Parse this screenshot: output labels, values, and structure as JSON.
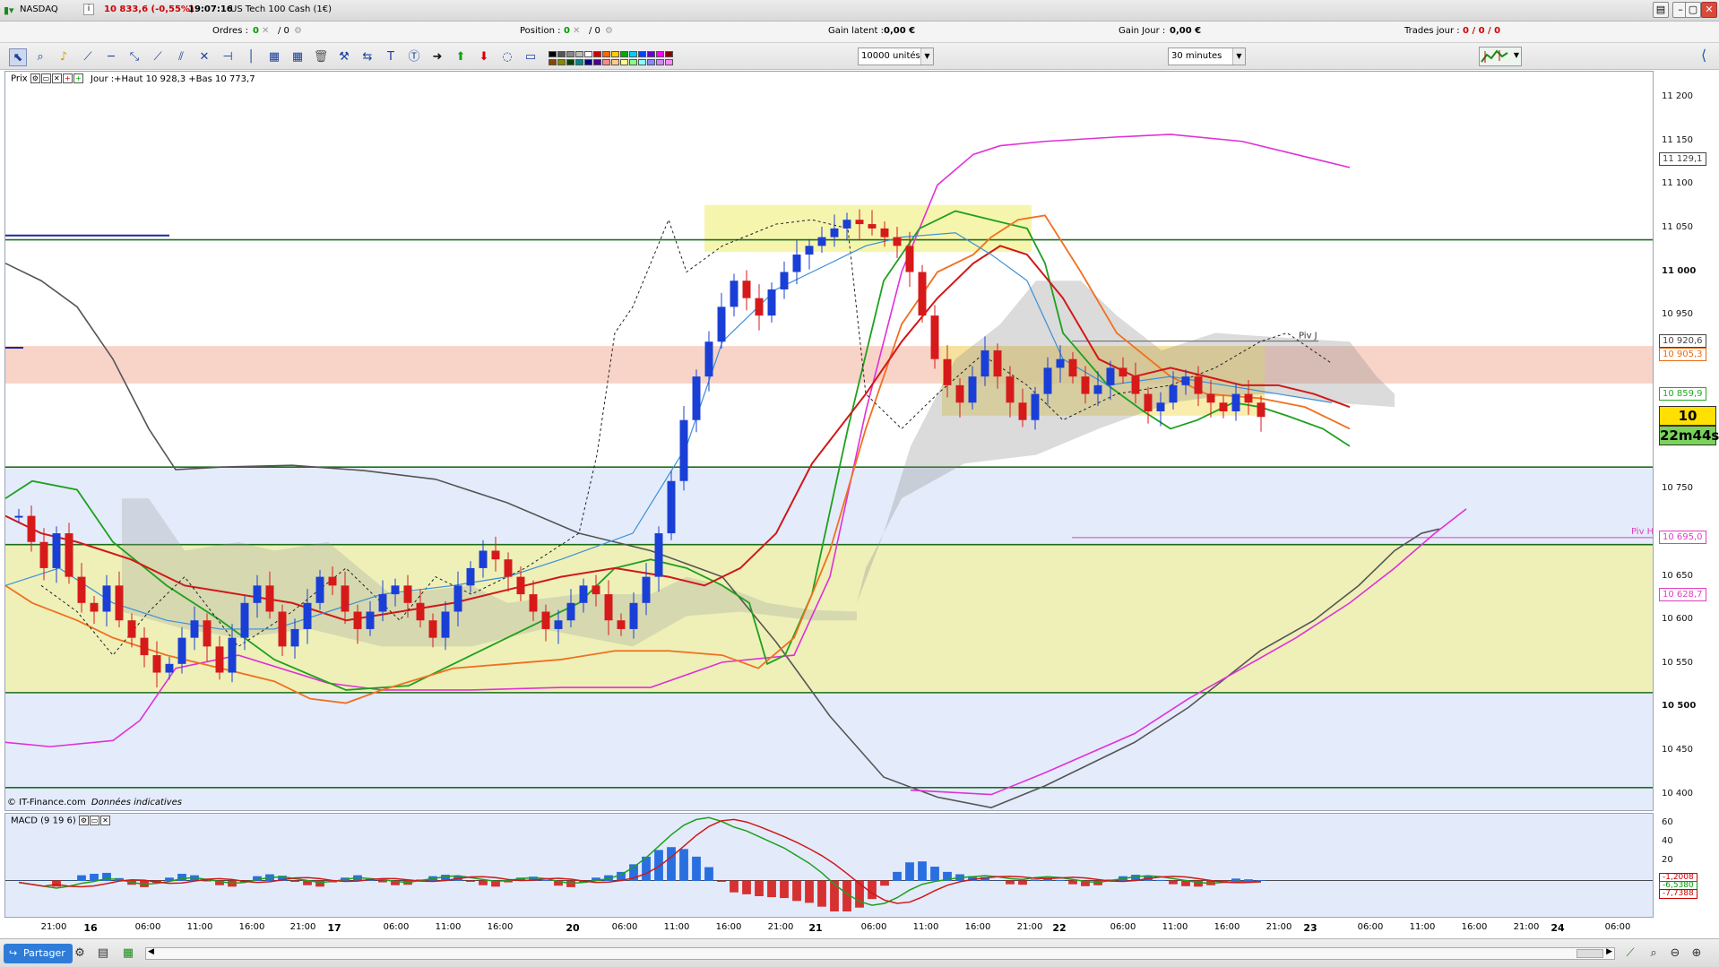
{
  "topbar": {
    "market": "NASDAQ",
    "info_icon": "i",
    "quote": "10 833,6 (-0,55%)",
    "time": "19:07:16",
    "instrument": "US Tech 100 Cash (1€)",
    "orders_label": "Ordres :",
    "orders_a": "0",
    "orders_b": "/ 0",
    "position_label": "Position :",
    "position_a": "0",
    "position_b": "/ 0",
    "gain_latent_label": "Gain latent :",
    "gain_latent_value": "0,00 €",
    "gain_jour_label": "Gain Jour :",
    "gain_jour_value": "0,00 €",
    "trades_label": "Trades jour :",
    "trades_value": "0 / 0 / 0"
  },
  "toolbar": {
    "units_select": "10000 unités",
    "period_select": "30 minutes",
    "icons": [
      "cursor-icon",
      "zoom-icon",
      "alert-bell-icon",
      "ruler-icon",
      "horizontal-line-icon",
      "trendline-icon",
      "ray-icon",
      "channel-icon",
      "fibonacci-icon",
      "vertical-line-icon",
      "ellipse-icon",
      "arc-icon",
      "text-icon",
      "callout-icon",
      "arrow-right-icon",
      "arrow-up-icon",
      "arrow-down-icon",
      "rectangle-icon",
      "delete-icon",
      "magnet-icon"
    ],
    "swatch_colors": [
      "#000000",
      "#555555",
      "#888888",
      "#bbbbbb",
      "#ffffff",
      "#d00000",
      "#ff6600",
      "#ffcc00",
      "#00aa00",
      "#00ccff",
      "#0044ff",
      "#6600cc",
      "#ff00ff",
      "#880000",
      "#884400",
      "#888800",
      "#004400",
      "#008888",
      "#000088",
      "#440088",
      "#ff8888",
      "#ffcc88",
      "#ffff88",
      "#88ff88",
      "#88ffff",
      "#8888ff",
      "#cc88ff",
      "#ff88ff"
    ]
  },
  "prix_bar": {
    "label": "Prix",
    "jour_info": "Jour :+Haut 10 928,3 +Bas 10 773,7"
  },
  "yaxis": {
    "labels": [
      {
        "text": "11 200",
        "value": 11200,
        "bold": false
      },
      {
        "text": "11 150",
        "value": 11150,
        "bold": false
      },
      {
        "text": "11 100",
        "value": 11100,
        "bold": false
      },
      {
        "text": "11 050",
        "value": 11050,
        "bold": false
      },
      {
        "text": "11 000",
        "value": 11000,
        "bold": true
      },
      {
        "text": "10 950",
        "value": 10950,
        "bold": false
      },
      {
        "text": "10 750",
        "value": 10750,
        "bold": false
      },
      {
        "text": "10 650",
        "value": 10650,
        "bold": false
      },
      {
        "text": "10 600",
        "value": 10600,
        "bold": false
      },
      {
        "text": "10 550",
        "value": 10550,
        "bold": false
      },
      {
        "text": "10 500",
        "value": 10500,
        "bold": true
      },
      {
        "text": "10 450",
        "value": 10450,
        "bold": false
      },
      {
        "text": "10 400",
        "value": 10400,
        "bold": false
      }
    ],
    "tags": [
      {
        "text": "11 129,1",
        "value": 11129.1,
        "color": "#444444"
      },
      {
        "text": "10 920,6",
        "value": 10920.6,
        "color": "#444444"
      },
      {
        "text": "10 905,3",
        "value": 10905.3,
        "color": "#e86a10"
      },
      {
        "text": "10 859,9",
        "value": 10859.9,
        "color": "#22aa22"
      },
      {
        "text": "10 695,0",
        "value": 10695.0,
        "color": "#e040c0"
      },
      {
        "text": "10 628,7",
        "value": 10628.7,
        "color": "#e040c0"
      }
    ],
    "last_price": "10 833,6",
    "countdown": "22m44s",
    "macd_labels": [
      {
        "text": "60",
        "value": 60
      },
      {
        "text": "40",
        "value": 40
      },
      {
        "text": "20",
        "value": 20
      },
      {
        "text": "0",
        "value": 0
      }
    ],
    "macd_tags": [
      {
        "text": "-1,2008",
        "color": "#cc0000"
      },
      {
        "text": "-6,5380",
        "color": "#009900"
      },
      {
        "text": "-7,7388",
        "color": "#cc0000"
      }
    ]
  },
  "annotations": {
    "piv_j": "Piv J",
    "piv_h": "Piv H",
    "copyright": "© IT-Finance.com",
    "data_note": "Données indicatives"
  },
  "macd": {
    "label": "MACD (9 19 6)"
  },
  "xaxis": {
    "labels": [
      {
        "text": "21:00",
        "bold": false
      },
      {
        "text": "16",
        "bold": true
      },
      {
        "text": "06:00",
        "bold": false
      },
      {
        "text": "11:00",
        "bold": false
      },
      {
        "text": "16:00",
        "bold": false
      },
      {
        "text": "21:00",
        "bold": false
      },
      {
        "text": "17",
        "bold": true
      },
      {
        "text": "06:00",
        "bold": false
      },
      {
        "text": "11:00",
        "bold": false
      },
      {
        "text": "16:00",
        "bold": false
      },
      {
        "text": "20",
        "bold": true
      },
      {
        "text": "06:00",
        "bold": false
      },
      {
        "text": "11:00",
        "bold": false
      },
      {
        "text": "16:00",
        "bold": false
      },
      {
        "text": "21:00",
        "bold": false
      },
      {
        "text": "21",
        "bold": true
      },
      {
        "text": "06:00",
        "bold": false
      },
      {
        "text": "11:00",
        "bold": false
      },
      {
        "text": "16:00",
        "bold": false
      },
      {
        "text": "21:00",
        "bold": false
      },
      {
        "text": "22",
        "bold": true
      },
      {
        "text": "06:00",
        "bold": false
      },
      {
        "text": "11:00",
        "bold": false
      },
      {
        "text": "16:00",
        "bold": false
      },
      {
        "text": "21:00",
        "bold": false
      },
      {
        "text": "23",
        "bold": true
      },
      {
        "text": "06:00",
        "bold": false
      },
      {
        "text": "11:00",
        "bold": false
      },
      {
        "text": "16:00",
        "bold": false
      },
      {
        "text": "21:00",
        "bold": false
      },
      {
        "text": "24",
        "bold": true
      },
      {
        "text": "06:00",
        "bold": false
      }
    ]
  },
  "bottombar": {
    "share_label": "Partager"
  },
  "chart_data": {
    "type": "candlestick",
    "instrument": "US Tech 100 Cash (1€)",
    "timeframe": "30 minutes",
    "ylim": [
      10380,
      11230
    ],
    "close_series": [
      10720,
      10690,
      10660,
      10700,
      10650,
      10620,
      10610,
      10640,
      10600,
      10580,
      10560,
      10540,
      10550,
      10580,
      10600,
      10570,
      10540,
      10580,
      10620,
      10640,
      10610,
      10570,
      10590,
      10620,
      10650,
      10640,
      10610,
      10590,
      10610,
      10630,
      10640,
      10620,
      10600,
      10580,
      10610,
      10640,
      10660,
      10680,
      10670,
      10650,
      10630,
      10610,
      10590,
      10600,
      10620,
      10640,
      10630,
      10600,
      10590,
      10620,
      10650,
      10700,
      10760,
      10830,
      10880,
      10920,
      10960,
      10990,
      10970,
      10950,
      10980,
      11000,
      11020,
      11030,
      11040,
      11050,
      11060,
      11055,
      11050,
      11040,
      11030,
      11000,
      10950,
      10900,
      10870,
      10850,
      10880,
      10910,
      10880,
      10850,
      10830,
      10860,
      10890,
      10900,
      10880,
      10860,
      10870,
      10890,
      10880,
      10860,
      10840,
      10850,
      10870,
      10880,
      10860,
      10850,
      10840,
      10860,
      10850,
      10833.6
    ],
    "horizontal_levels": [
      11037,
      10776,
      10687,
      10517,
      10408
    ],
    "pivots": [
      {
        "name": "Piv J",
        "value": 10920.6
      },
      {
        "name": "Piv H",
        "value": 10695.0
      }
    ],
    "macd_range": [
      -40,
      70
    ]
  }
}
